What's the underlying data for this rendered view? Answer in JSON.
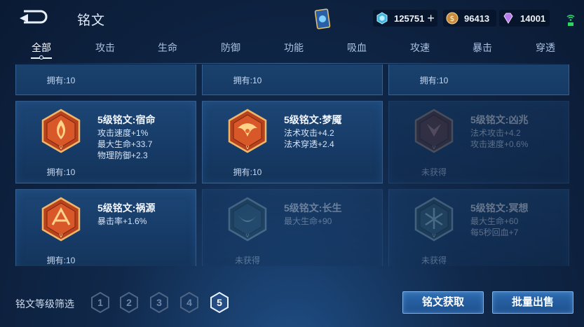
{
  "header": {
    "title": "铭文",
    "resources": [
      {
        "name": "diamond",
        "value": "125751",
        "color": "#5ad2f0"
      },
      {
        "name": "gold",
        "value": "96413",
        "color": "#d9a35a"
      },
      {
        "name": "gem",
        "value": "14001",
        "color": "#c58bf0"
      }
    ]
  },
  "tabs": [
    "全部",
    "攻击",
    "生命",
    "防御",
    "功能",
    "吸血",
    "攻速",
    "暴击",
    "穿透"
  ],
  "active_tab": "全部",
  "top_row": [
    "拥有:10",
    "拥有:10",
    "拥有:10"
  ],
  "cards": [
    {
      "title": "5级铭文:宿命",
      "attrs": [
        "攻击速度+1%",
        "最大生命+33.7",
        "物理防御+2.3"
      ],
      "status": "拥有:10",
      "owned": true
    },
    {
      "title": "5级铭文:梦魇",
      "attrs": [
        "法术攻击+4.2",
        "法术穿透+2.4"
      ],
      "status": "拥有:10",
      "owned": true
    },
    {
      "title": "5级铭文:凶兆",
      "attrs": [
        "法术攻击+4.2",
        "攻击速度+0.6%"
      ],
      "status": "未获得",
      "owned": false
    },
    {
      "title": "5级铭文:祸源",
      "attrs": [
        "暴击率+1.6%"
      ],
      "status": "拥有:10",
      "owned": true
    },
    {
      "title": "5级铭文:长生",
      "attrs": [
        "最大生命+90"
      ],
      "status": "未获得",
      "owned": false
    },
    {
      "title": "5级铭文:冥想",
      "attrs": [
        "最大生命+60",
        "每5秒回血+7"
      ],
      "status": "未获得",
      "owned": false
    }
  ],
  "footer": {
    "filter_label": "铭文等级筛选",
    "levels": [
      "1",
      "2",
      "3",
      "4",
      "5"
    ],
    "active_level": "5",
    "acquire_button": "铭文获取",
    "sell_button": "批量出售"
  }
}
